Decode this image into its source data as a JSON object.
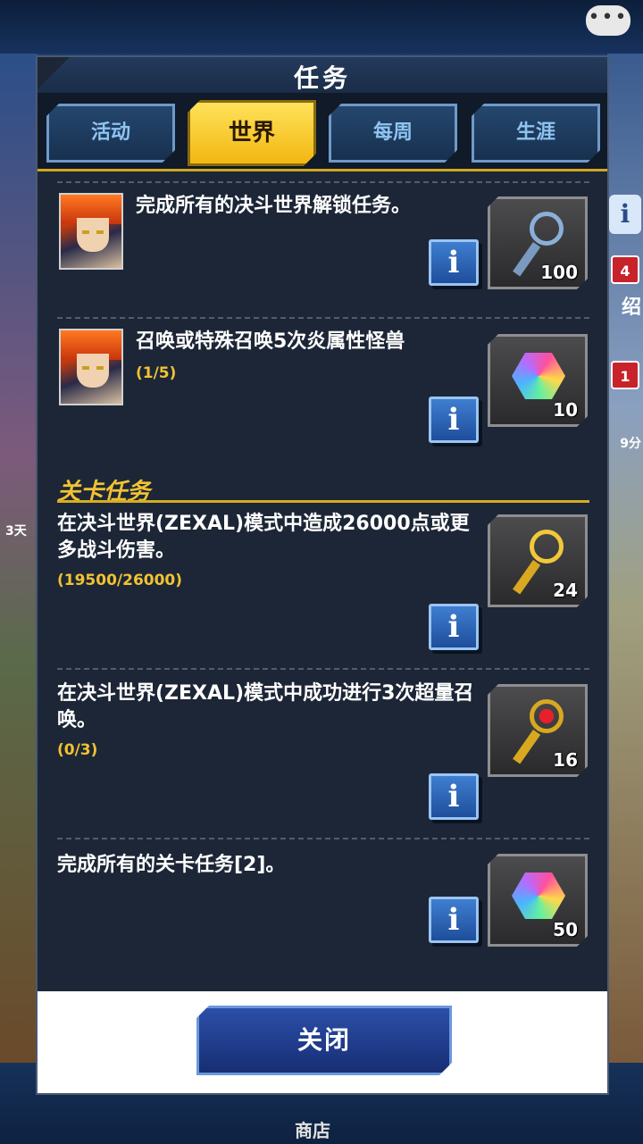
{
  "background": {
    "right_labels": [
      "4",
      "绍",
      "1",
      "9分"
    ],
    "left_label": "3天",
    "bottom_nav_shop": "商店"
  },
  "dialog": {
    "title": "任务",
    "tabs": [
      {
        "label": "活动",
        "active": false
      },
      {
        "label": "世界",
        "active": true
      },
      {
        "label": "每周",
        "active": false
      },
      {
        "label": "生涯",
        "active": false
      }
    ],
    "missions": [
      {
        "text": "完成所有的决斗世界解锁任务。",
        "progress": "",
        "reward_icon": "silver-key-icon",
        "reward_count": "100"
      },
      {
        "text": "召唤或特殊召唤5次炎属性怪兽",
        "progress": "(1/5)",
        "reward_icon": "gem-icon",
        "reward_count": "10"
      }
    ],
    "section_title": "关卡任务",
    "stage_missions": [
      {
        "text": "在决斗世界(ZEXAL)模式中造成26000点或更多战斗伤害。",
        "progress": "(19500/26000)",
        "reward_icon": "gold-key-icon",
        "reward_count": "24"
      },
      {
        "text": "在决斗世界(ZEXAL)模式中成功进行3次超量召唤。",
        "progress": "(0/3)",
        "reward_icon": "red-key-icon",
        "reward_count": "16"
      },
      {
        "text": "完成所有的关卡任务[2]。",
        "progress": "",
        "reward_icon": "gem-icon",
        "reward_count": "50"
      }
    ],
    "info_label": "i",
    "close_label": "关闭"
  }
}
